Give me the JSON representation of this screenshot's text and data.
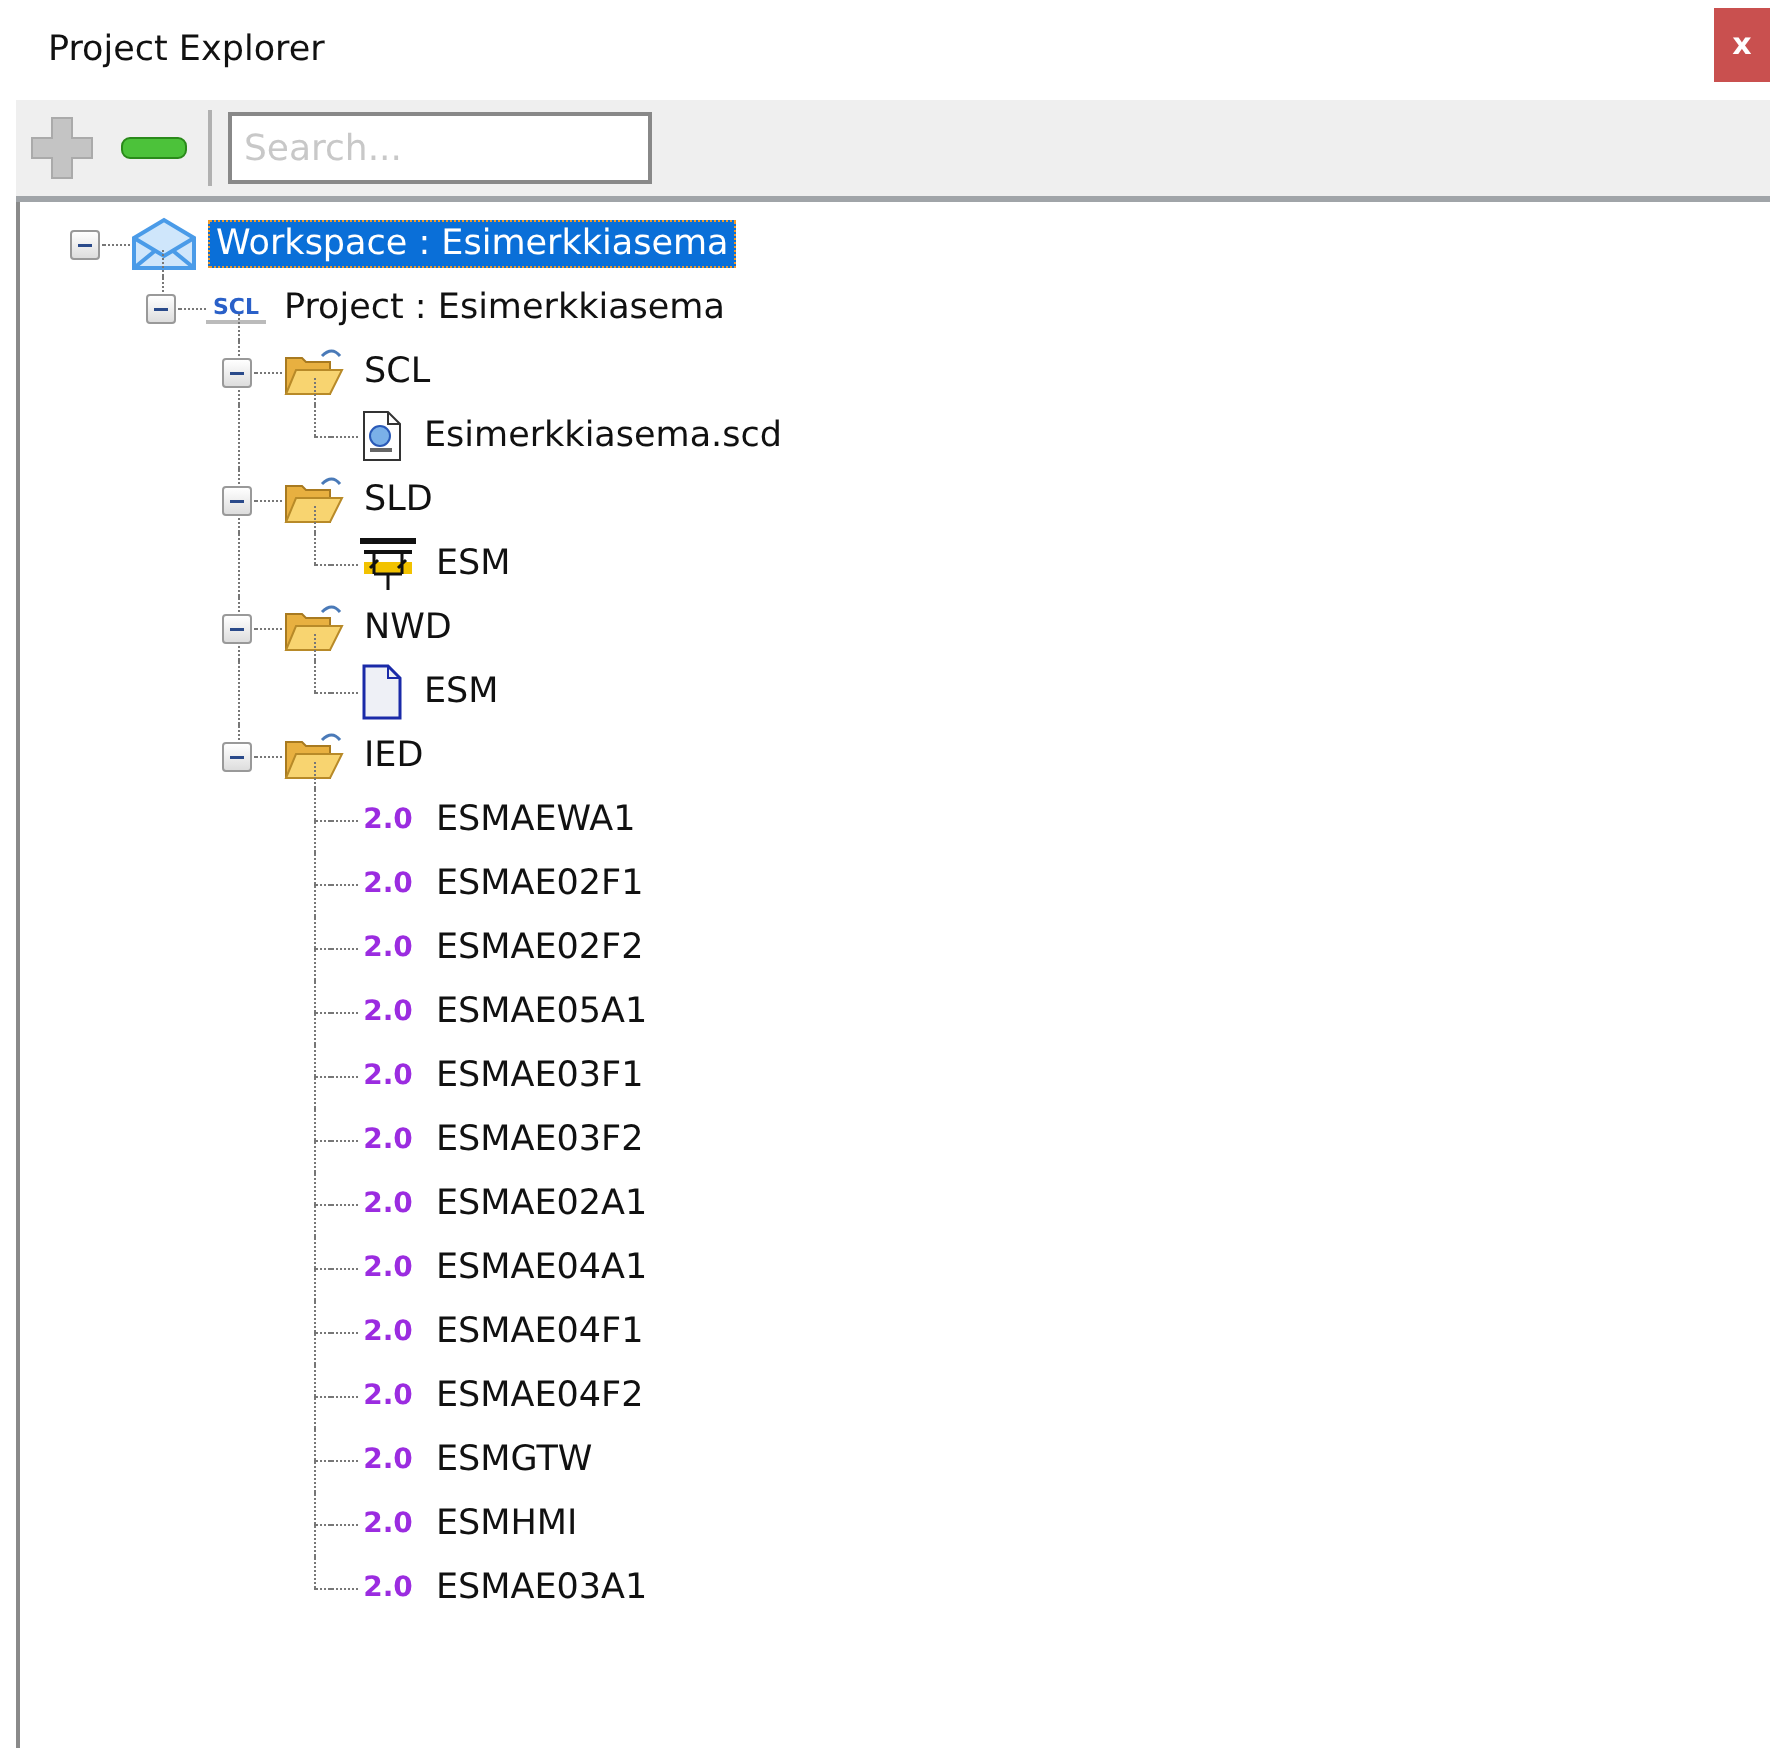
{
  "window": {
    "title": "Project Explorer",
    "close": "x"
  },
  "toolbar": {
    "add": {
      "disabled": true
    },
    "remove": {
      "disabled": false
    },
    "search": {
      "placeholder": "Search..."
    }
  },
  "tree": [
    {
      "kind": "workspace",
      "label": "Workspace : Esimerkkiasema",
      "selected": true,
      "expanded": true,
      "children": [
        {
          "kind": "project",
          "badge": "SCL",
          "label": "Project : Esimerkkiasema",
          "selected": false,
          "expanded": true,
          "children": [
            {
              "kind": "folder",
              "label": "SCL",
              "selected": false,
              "expanded": true,
              "children": [
                {
                  "kind": "file",
                  "label": "Esimerkkiasema.scd",
                  "selected": false
                }
              ]
            },
            {
              "kind": "folder",
              "label": "SLD",
              "selected": false,
              "expanded": true,
              "children": [
                {
                  "kind": "diagram",
                  "label": "ESM",
                  "selected": false
                }
              ]
            },
            {
              "kind": "folder",
              "label": "NWD",
              "selected": false,
              "expanded": true,
              "children": [
                {
                  "kind": "document",
                  "label": "ESM",
                  "selected": false
                }
              ]
            },
            {
              "kind": "folder",
              "label": "IED",
              "selected": false,
              "expanded": true,
              "children": [
                {
                  "kind": "ied",
                  "badge": "2.0",
                  "label": "ESMAEWA1",
                  "selected": false
                },
                {
                  "kind": "ied",
                  "badge": "2.0",
                  "label": "ESMAE02F1",
                  "selected": false
                },
                {
                  "kind": "ied",
                  "badge": "2.0",
                  "label": "ESMAE02F2",
                  "selected": false
                },
                {
                  "kind": "ied",
                  "badge": "2.0",
                  "label": "ESMAE05A1",
                  "selected": false
                },
                {
                  "kind": "ied",
                  "badge": "2.0",
                  "label": "ESMAE03F1",
                  "selected": false
                },
                {
                  "kind": "ied",
                  "badge": "2.0",
                  "label": "ESMAE03F2",
                  "selected": false
                },
                {
                  "kind": "ied",
                  "badge": "2.0",
                  "label": "ESMAE02A1",
                  "selected": false
                },
                {
                  "kind": "ied",
                  "badge": "2.0",
                  "label": "ESMAE04A1",
                  "selected": false
                },
                {
                  "kind": "ied",
                  "badge": "2.0",
                  "label": "ESMAE04F1",
                  "selected": false
                },
                {
                  "kind": "ied",
                  "badge": "2.0",
                  "label": "ESMAE04F2",
                  "selected": false
                },
                {
                  "kind": "ied",
                  "badge": "2.0",
                  "label": "ESMGTW",
                  "selected": false
                },
                {
                  "kind": "ied",
                  "badge": "2.0",
                  "label": "ESMHMI",
                  "selected": false
                },
                {
                  "kind": "ied",
                  "badge": "2.0",
                  "label": "ESMAE03A1",
                  "selected": false
                }
              ]
            }
          ]
        }
      ]
    }
  ]
}
